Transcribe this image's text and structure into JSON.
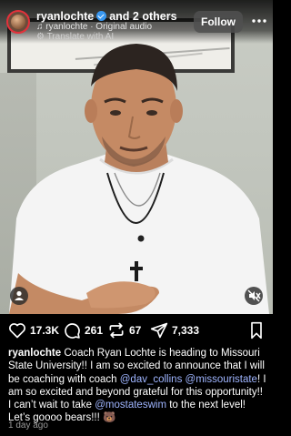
{
  "post": {
    "username": "ryanlochte",
    "collab_suffix": "and 2 others",
    "audio": "ryanlochte · Original audio",
    "translate": "Translate with AI",
    "follow_label": "Follow"
  },
  "actions": {
    "likes": "17.3K",
    "comments": "261",
    "reposts": "67",
    "shares": "7,333"
  },
  "caption": {
    "username": "ryanlochte",
    "text_1": " Coach Ryan Lochte is heading to Missouri State University!! I am so excited to announce that I will be coaching with coach ",
    "mention_1": "@dav_collins",
    "text_2": " ",
    "mention_2": "@missouristate",
    "text_3": "! I am so excited and beyond grateful for this opportunity!! I can’t wait to take ",
    "mention_3": "@mostateswim",
    "text_4": " to the next level! Let’s goooo bears!!! 🐻"
  },
  "timestamp": "1 day ago",
  "colors": {
    "verified": "#3897f0",
    "mention": "#9fb5ff",
    "avatar_ring": "#e3313b"
  },
  "icons": [
    "heart-icon",
    "comment-icon",
    "repost-icon",
    "share-icon",
    "bookmark-icon",
    "more-icon",
    "person-tag-icon",
    "mute-icon",
    "translate-icon",
    "music-note-icon"
  ]
}
